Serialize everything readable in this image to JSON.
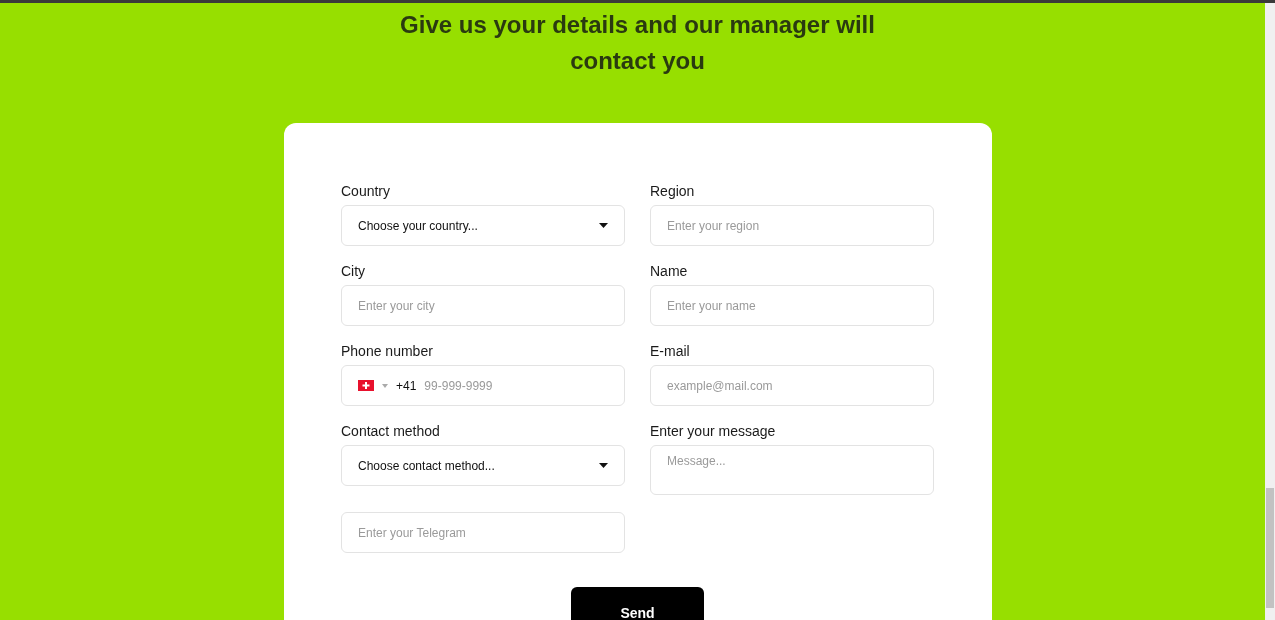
{
  "heading": "Give us your details and our manager will contact you",
  "fields": [
    {
      "kind": "select",
      "label": "Country",
      "value": "Choose your country..."
    },
    {
      "kind": "input",
      "label": "Region",
      "placeholder": "Enter your region"
    },
    {
      "kind": "input",
      "label": "City",
      "placeholder": "Enter your city"
    },
    {
      "kind": "input",
      "label": "Name",
      "placeholder": "Enter your name"
    },
    {
      "kind": "phone",
      "label": "Phone number",
      "code": "+41",
      "placeholder": "99-999-9999"
    },
    {
      "kind": "input",
      "label": "E-mail",
      "placeholder": "example@mail.com"
    },
    {
      "kind": "select",
      "label": "Contact method",
      "value": "Choose contact method..."
    },
    {
      "kind": "textarea",
      "label": "Enter your message",
      "placeholder": "Message..."
    },
    {
      "kind": "input",
      "placeholder": "Enter your Telegram"
    }
  ],
  "submit": "Send"
}
